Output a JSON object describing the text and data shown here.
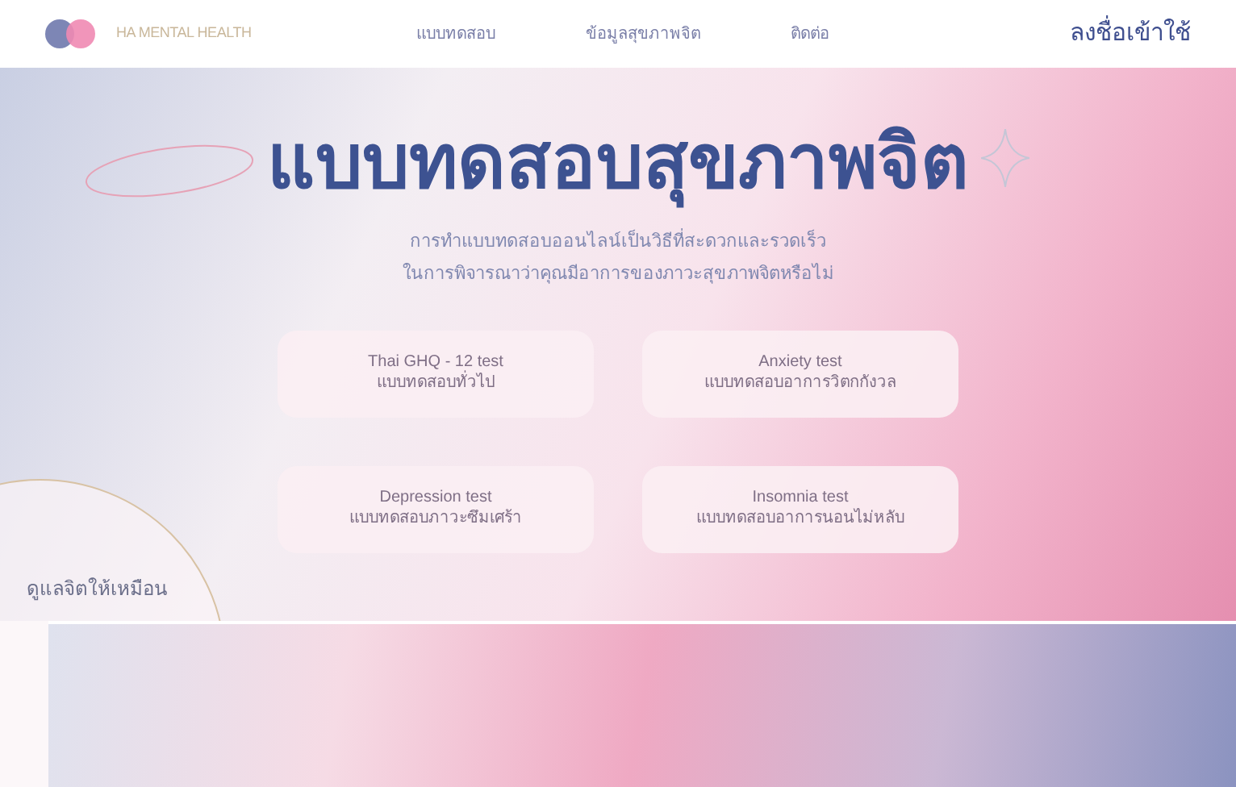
{
  "header": {
    "logo_text": "HA MENTAL HEALTH",
    "nav": [
      {
        "label": "แบบทดสอบ"
      },
      {
        "label": "ข้อมูลสุขภาพจิต"
      },
      {
        "label": "ติดต่อ"
      }
    ],
    "login": "ลงชื่อเข้าใช้"
  },
  "hero": {
    "title": "แบบทดสอบสุขภาพจิต",
    "subtitle": [
      "การทำแบบทดสอบออนไลน์เป็นวิธีที่สะดวกและรวดเร็ว",
      "ในการพิจารณาว่าคุณมีอาการของภาวะสุขภาพจิตหรือไม่"
    ],
    "tests": [
      {
        "name": "Thai GHQ - 12 test",
        "description": "แบบทดสอบทั่วไป"
      },
      {
        "name": "Anxiety test",
        "description": "แบบทดสอบอาการวิตกกังวล"
      },
      {
        "name": "Depression test",
        "description": "แบบทดสอบภาวะซึมเศร้า"
      },
      {
        "name": "Insomnia test",
        "description": "แบบทดสอบอาการนอนไม่หลับ"
      }
    ],
    "side_text": "ดูแลจิตให้เหมือน"
  }
}
